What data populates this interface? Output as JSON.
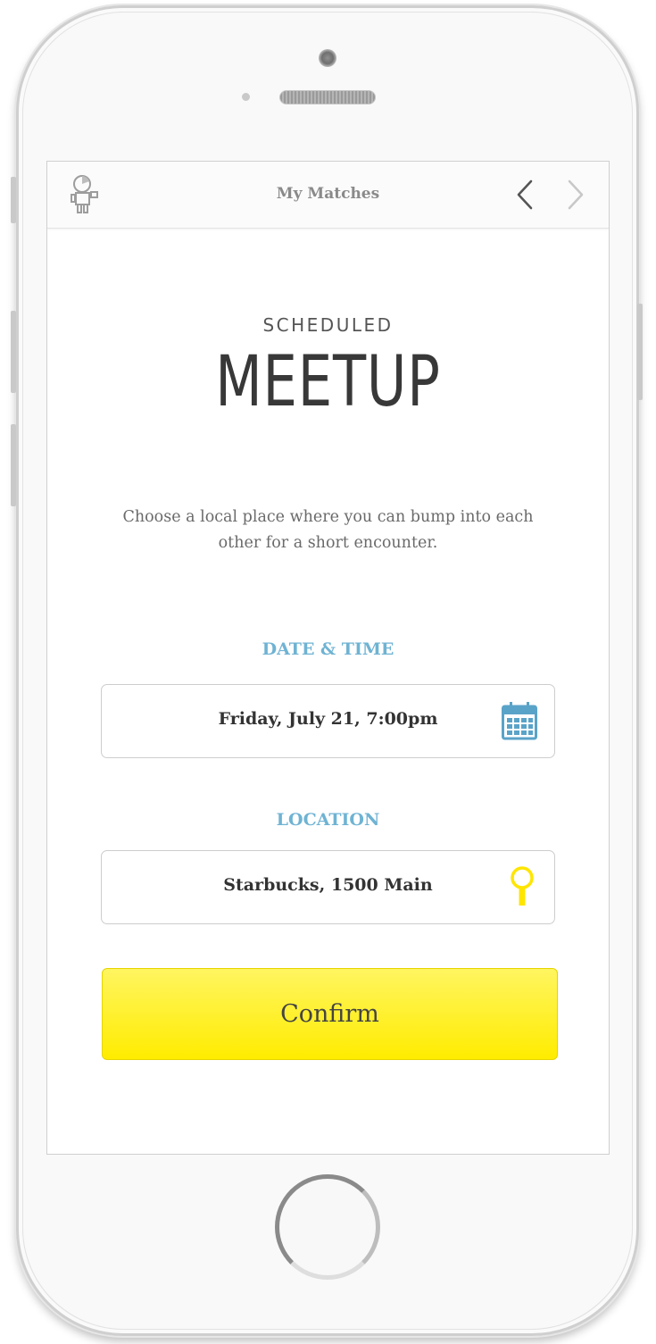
{
  "nav": {
    "title": "My Matches"
  },
  "header": {
    "kicker": "SCHEDULED",
    "headline": "MEETUP"
  },
  "description": "Choose a local place where you can bump into each other for a short encounter.",
  "date_time": {
    "label": "DATE & TIME",
    "value": "Friday, July 21, 7:00pm"
  },
  "location": {
    "label": "LOCATION",
    "value": "Starbucks, 1500 Main"
  },
  "confirm": {
    "label": "Confirm"
  },
  "colors": {
    "accent_blue": "#6fb3d3",
    "confirm_yellow": "#ffec00",
    "text_dark": "#333333"
  },
  "icons": {
    "avatar": "avatar-icon",
    "prev": "chevron-left-icon",
    "next": "chevron-right-icon",
    "calendar": "calendar-icon",
    "location": "location-pin-icon"
  }
}
